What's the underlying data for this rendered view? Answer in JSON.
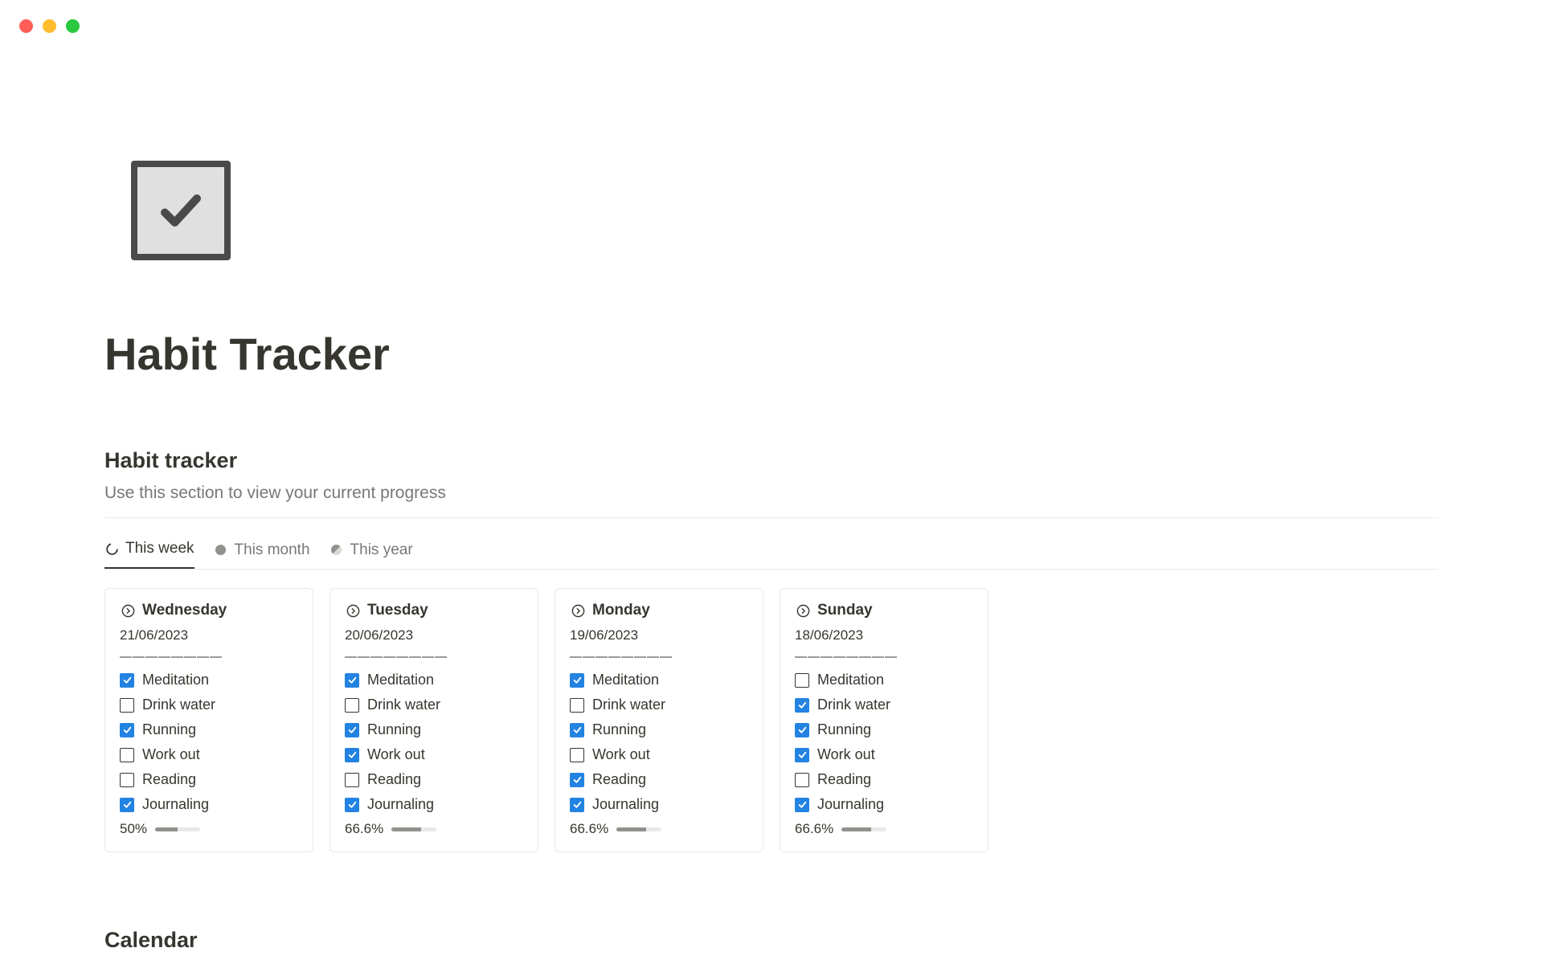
{
  "page": {
    "title": "Habit Tracker"
  },
  "section": {
    "heading": "Habit tracker",
    "subtitle": "Use this section to view your current progress"
  },
  "tabs": [
    {
      "label": "This week",
      "active": true,
      "icon": "spinner"
    },
    {
      "label": "This month",
      "active": false,
      "icon": "circle"
    },
    {
      "label": "This year",
      "active": false,
      "icon": "partial"
    }
  ],
  "days": [
    {
      "name": "Wednesday",
      "date": "21/06/2023",
      "divider": "————————",
      "habits": [
        {
          "label": "Meditation",
          "done": true
        },
        {
          "label": "Drink water",
          "done": false
        },
        {
          "label": "Running",
          "done": true
        },
        {
          "label": "Work out",
          "done": false
        },
        {
          "label": "Reading",
          "done": false
        },
        {
          "label": "Journaling",
          "done": true
        }
      ],
      "pct": "50%",
      "fill": 50
    },
    {
      "name": "Tuesday",
      "date": "20/06/2023",
      "divider": "————————",
      "habits": [
        {
          "label": "Meditation",
          "done": true
        },
        {
          "label": "Drink water",
          "done": false
        },
        {
          "label": "Running",
          "done": true
        },
        {
          "label": "Work out",
          "done": true
        },
        {
          "label": "Reading",
          "done": false
        },
        {
          "label": "Journaling",
          "done": true
        }
      ],
      "pct": "66.6%",
      "fill": 66.6
    },
    {
      "name": "Monday",
      "date": "19/06/2023",
      "divider": "————————",
      "habits": [
        {
          "label": "Meditation",
          "done": true
        },
        {
          "label": "Drink water",
          "done": false
        },
        {
          "label": "Running",
          "done": true
        },
        {
          "label": "Work out",
          "done": false
        },
        {
          "label": "Reading",
          "done": true
        },
        {
          "label": "Journaling",
          "done": true
        }
      ],
      "pct": "66.6%",
      "fill": 66.6
    },
    {
      "name": "Sunday",
      "date": "18/06/2023",
      "divider": "————————",
      "habits": [
        {
          "label": "Meditation",
          "done": false
        },
        {
          "label": "Drink water",
          "done": true
        },
        {
          "label": "Running",
          "done": true
        },
        {
          "label": "Work out",
          "done": true
        },
        {
          "label": "Reading",
          "done": false
        },
        {
          "label": "Journaling",
          "done": true
        }
      ],
      "pct": "66.6%",
      "fill": 66.6
    }
  ],
  "calendar": {
    "heading": "Calendar"
  }
}
